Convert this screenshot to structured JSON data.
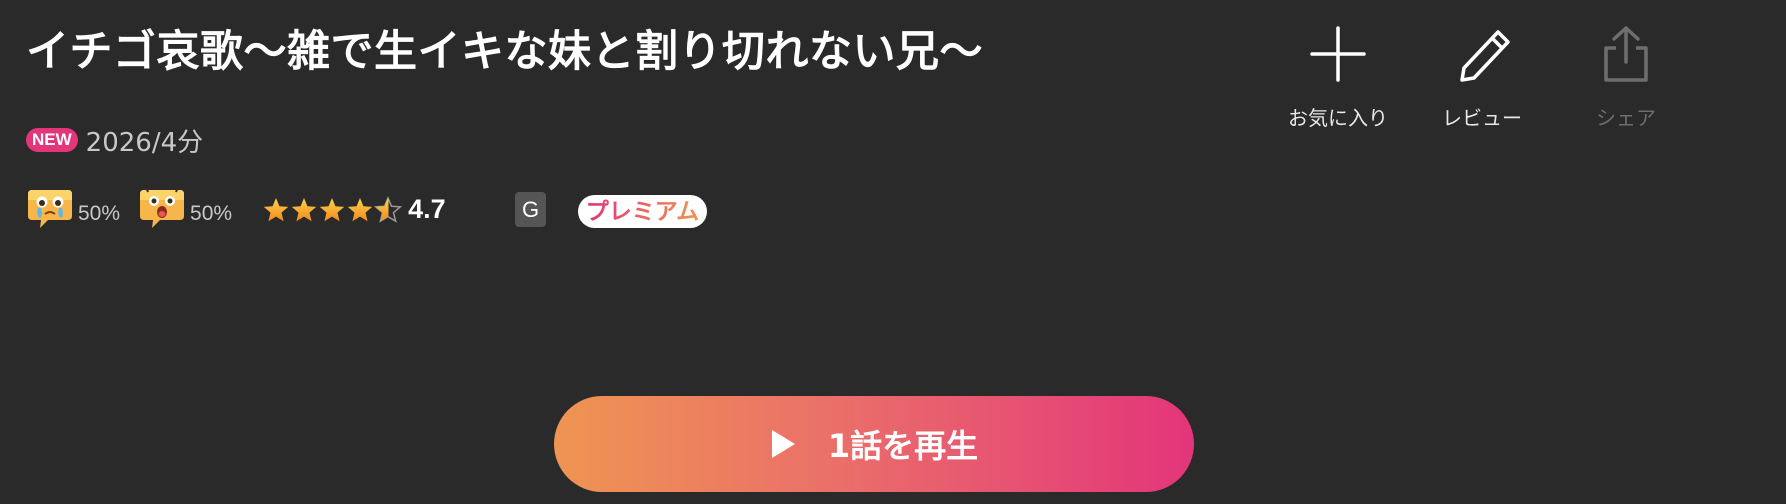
{
  "title": "イチゴ哀歌〜雑で生イキな妹と割り切れない兄〜",
  "badges": {
    "new": "NEW",
    "rating_class": "G",
    "premium": "プレミアム"
  },
  "release": "2026/4分",
  "reactions": [
    {
      "icon": "crying-face-icon",
      "percent": "50%"
    },
    {
      "icon": "shocked-face-icon",
      "percent": "50%"
    }
  ],
  "rating": {
    "value": "4.7",
    "max": 5,
    "stars_filled": 4.7
  },
  "actions": {
    "favorite": {
      "label": "お気に入り",
      "icon": "plus-icon"
    },
    "review": {
      "label": "レビュー",
      "icon": "pencil-icon"
    },
    "share": {
      "label": "シェア",
      "icon": "share-icon",
      "disabled": true
    }
  },
  "play_button": {
    "label": "1話を再生",
    "icon": "play-icon"
  },
  "colors": {
    "background": "#2a2a2a",
    "accent_pink": "#e3357a",
    "accent_orange": "#ef9552",
    "star": "#f6a623"
  }
}
